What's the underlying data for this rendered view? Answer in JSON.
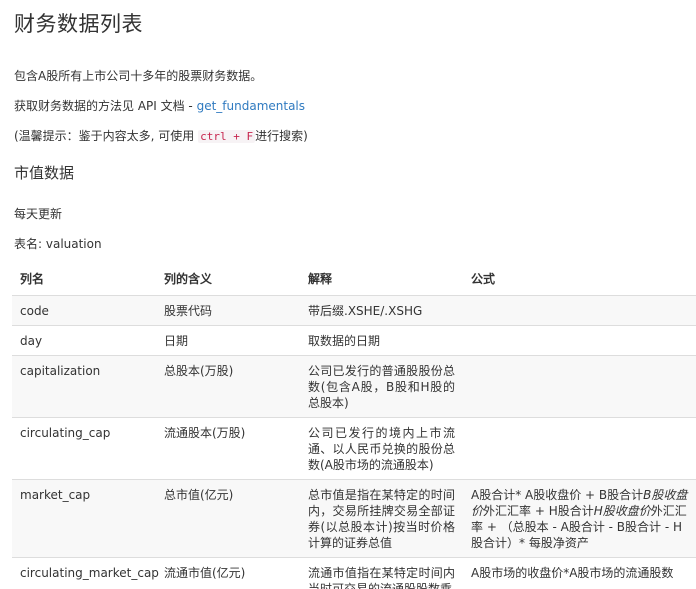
{
  "page": {
    "title": "财务数据列表",
    "intro": "包含A股所有上市公司十多年的股票财务数据。",
    "api_prefix": "获取财务数据的方法见 API 文档 - ",
    "api_link": "get_fundamentals",
    "tip_prefix": "(温馨提示：鉴于内容太多, 可使用 ",
    "tip_code": "ctrl + F",
    "tip_suffix": "进行搜索)"
  },
  "section": {
    "heading": "市值数据",
    "update": "每天更新",
    "table_name": "表名: valuation"
  },
  "table": {
    "headers": [
      "列名",
      "列的含义",
      "解释",
      "公式"
    ],
    "rows": [
      {
        "col": "code",
        "meaning": "股票代码",
        "desc": "带后缀.XSHE/.XSHG",
        "formula": ""
      },
      {
        "col": "day",
        "meaning": "日期",
        "desc": "取数据的日期",
        "formula": ""
      },
      {
        "col": "capitalization",
        "meaning": "总股本(万股)",
        "desc": "公司已发行的普通股股份总数(包含A股，B股和H股的总股本)",
        "formula": ""
      },
      {
        "col": "circulating_cap",
        "meaning": "流通股本(万股)",
        "desc": "公司已发行的境内上市流通、以人民币兑换的股份总数(A股市场的流通股本)",
        "formula": ""
      },
      {
        "col": "market_cap",
        "meaning": "总市值(亿元)",
        "desc": "总市值是指在某特定的时间内，交易所挂牌交易全部证券(以总股本计)按当时价格计算的证券总值",
        "formula_parts": [
          "A股合计* A股收盘价 + B股合计",
          "B股收盘价",
          "外汇汇率 + H股合计",
          "H股收盘价",
          "外汇汇率 + （总股本 - A股合计 - B股合计 - H股合计）* 每股净资产"
        ]
      },
      {
        "col": "circulating_market_cap",
        "meaning": "流通市值(亿元)",
        "desc": "流通市值指在某特定时间内当时可交易的流通股股数乘",
        "formula": "A股市场的收盘价*A股市场的流通股数"
      }
    ]
  }
}
